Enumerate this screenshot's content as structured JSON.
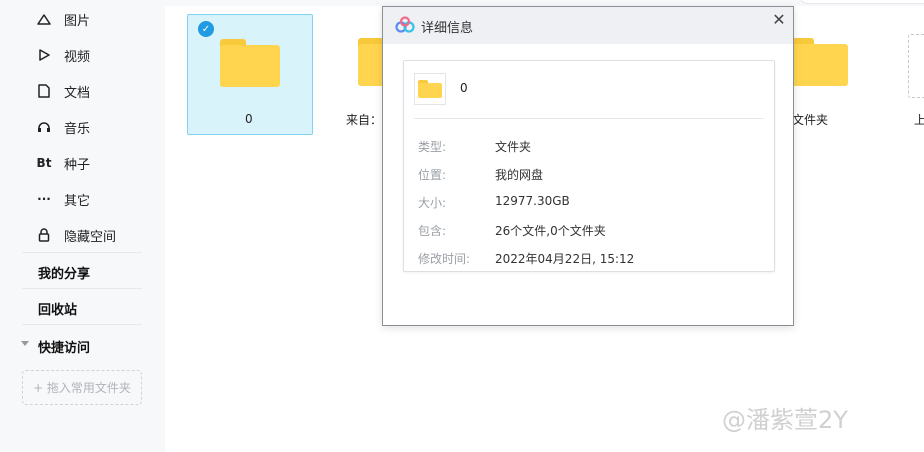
{
  "sidebar": {
    "items": [
      {
        "label": "图片",
        "icon": "mountain-icon"
      },
      {
        "label": "视频",
        "icon": "play-icon"
      },
      {
        "label": "文档",
        "icon": "document-icon"
      },
      {
        "label": "音乐",
        "icon": "headphones-icon"
      },
      {
        "label": "种子",
        "icon": "bt-icon",
        "glyph": "Bt"
      },
      {
        "label": "其它",
        "icon": "more-icon",
        "glyph": "···"
      },
      {
        "label": "隐藏空间",
        "icon": "lock-icon"
      }
    ],
    "my_share": "我的分享",
    "recycle": "回收站",
    "quick_access": "快捷访问",
    "add_folder": "+ 拖入常用文件夹"
  },
  "files": [
    {
      "name": "0",
      "selected": true
    },
    {
      "name": "来自：",
      "selected": false
    },
    {
      "name": "文件夹",
      "selected": false
    },
    {
      "name": "上",
      "selected": false
    }
  ],
  "dialog": {
    "title": "详细信息",
    "close_glyph": "✕",
    "item_name": "0",
    "rows": [
      {
        "key": "类型:",
        "value": "文件夹"
      },
      {
        "key": "位置:",
        "value": "我的网盘"
      },
      {
        "key": "大小:",
        "value": "12977.30GB"
      },
      {
        "key": "包含:",
        "value": "26个文件,0个文件夹"
      },
      {
        "key": "修改时间:",
        "value": "2022年04月22日, 15:12"
      }
    ]
  },
  "watermark": "@潘紫萱2Y",
  "colors": {
    "accent": "#1e9be3",
    "folder": "#ffd54f",
    "selected_bg": "#d9f3fb",
    "sidebar_bg": "#f7f8fa"
  }
}
